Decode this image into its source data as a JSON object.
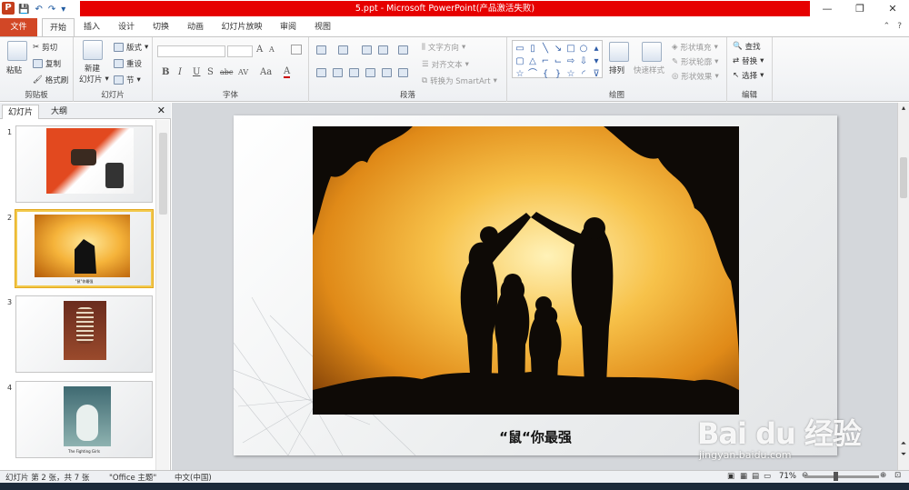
{
  "titlebar": {
    "title": "5.ppt  -  Microsoft PowerPoint(产品激活失败)",
    "app_letter": "P",
    "minimize": "—",
    "restore": "❐",
    "close": "✕"
  },
  "tabs": {
    "file": "文件",
    "items": [
      "开始",
      "插入",
      "设计",
      "切换",
      "动画",
      "幻灯片放映",
      "审阅",
      "视图"
    ]
  },
  "ribbon": {
    "clipboard": {
      "title": "剪贴板",
      "paste": "粘贴",
      "cut": "剪切",
      "copy": "复制",
      "format_painter": "格式刷"
    },
    "slides": {
      "title": "幻灯片",
      "new_slide": "新建",
      "new_slide2": "幻灯片",
      "layout": "版式",
      "reset": "重设",
      "section": "节"
    },
    "font": {
      "title": "字体",
      "bold": "B",
      "italic": "I",
      "underline": "U",
      "strike": "S",
      "shadow": "abc",
      "spacing": "AV",
      "case": "Aa",
      "color": "A",
      "grow": "A",
      "shrink": "A"
    },
    "paragraph": {
      "title": "段落",
      "text_direction": "文字方向",
      "align_text": "对齐文本",
      "smartart": "转换为 SmartArt"
    },
    "drawing": {
      "title": "绘图",
      "arrange": "排列",
      "quick_styles": "快速样式",
      "fill": "形状填充",
      "outline": "形状轮廓",
      "effects": "形状效果"
    },
    "editing": {
      "title": "编辑",
      "find": "查找",
      "replace": "替换",
      "select": "选择"
    }
  },
  "panel": {
    "tab_slides": "幻灯片",
    "tab_outline": "大纲",
    "close": "✕",
    "thumbnails": [
      {
        "num": "1",
        "caption": ""
      },
      {
        "num": "2",
        "caption": "\"鼠\"你最强"
      },
      {
        "num": "3",
        "caption": ""
      },
      {
        "num": "4",
        "caption": "The Fighting Girls"
      }
    ]
  },
  "slide": {
    "caption": "“鼠“你最强"
  },
  "watermark": {
    "brand": "Bai du 经验",
    "url": "jingyan.baidu.com"
  },
  "status": {
    "slide_info": "幻灯片 第 2 张，共 7 张",
    "theme": "\"Office 主题\"",
    "language": "中文(中国)",
    "zoom": "71%"
  }
}
